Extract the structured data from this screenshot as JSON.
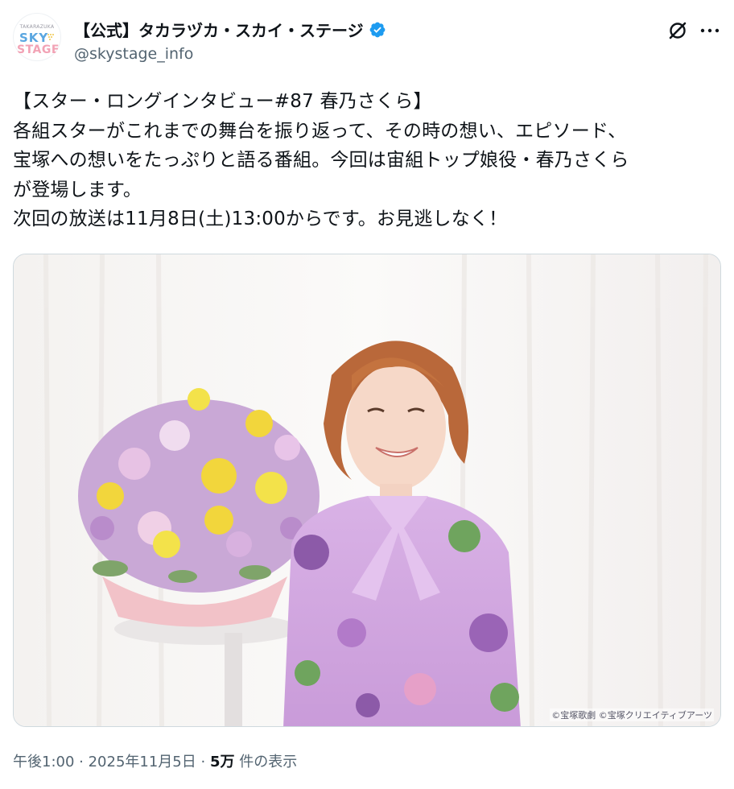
{
  "account": {
    "display_name": "【公式】タカラヅカ・スカイ・ステージ",
    "handle": "@skystage_info",
    "avatar_top_text": "TAKARAZUKA",
    "avatar_line1": "SKY",
    "avatar_line2": "STAGE",
    "verified_color": "#1d9bf0"
  },
  "tweet": {
    "text": "【スター・ロングインタビュー#87 春乃さくら】\n各組スターがこれまでの舞台を振り返って、その時の想い、エピソード、\n宝塚への想いをたっぷりと語る番組。今回は宙組トップ娘役・春乃さくら\nが登場します。\n次回の放送は11月8日(土)13:00からです。お見逃しなく！",
    "image_credit": "©宝塚歌劇 ©宝塚クリエイティブアーツ"
  },
  "meta": {
    "time": "午後1:00",
    "sep1": " · ",
    "date": "2025年11月5日",
    "sep2": " · ",
    "views_count": "5万",
    "views_label": " 件の表示"
  },
  "icons": {
    "header_actions": [
      "grok-icon",
      "more-icon"
    ]
  }
}
